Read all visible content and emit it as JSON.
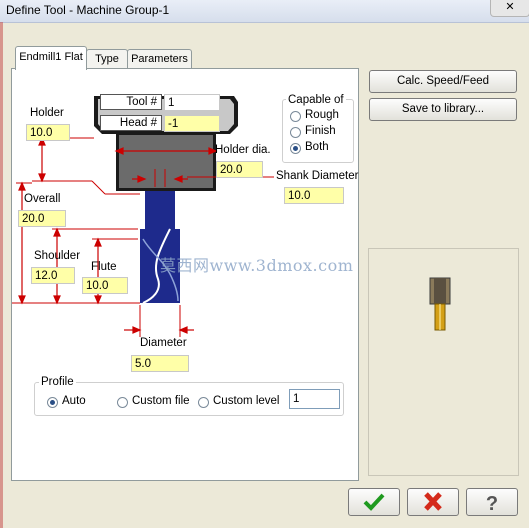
{
  "window": {
    "title": "Define Tool - Machine Group-1",
    "close": "✕"
  },
  "tabs": [
    "Endmill1 Flat",
    "Type",
    "Parameters"
  ],
  "header": {
    "tool_label": "Tool #",
    "tool_value": "1",
    "head_label": "Head #",
    "head_value": "-1"
  },
  "fields": {
    "holder_label": "Holder",
    "holder_value": "10.0",
    "holder_dia_label": "Holder dia.",
    "holder_dia_value": "20.0",
    "shank_label": "Shank Diameter",
    "shank_value": "10.0",
    "overall_label": "Overall",
    "overall_value": "20.0",
    "shoulder_label": "Shoulder",
    "shoulder_value": "12.0",
    "flute_label": "Flute",
    "flute_value": "10.0",
    "diameter_label": "Diameter",
    "diameter_value": "5.0"
  },
  "capable": {
    "title": "Capable of",
    "options": [
      "Rough",
      "Finish",
      "Both"
    ],
    "selected": "Both"
  },
  "profile": {
    "title": "Profile",
    "options": [
      "Auto",
      "Custom file",
      "Custom level"
    ],
    "selected": "Auto",
    "level_value": "1"
  },
  "buttons": {
    "calc": "Calc. Speed/Feed",
    "save": "Save to library..."
  },
  "watermark": "莫西网www.3dmox.com",
  "colors": {
    "field_bg": "#ffffa8",
    "dimension_red": "#cc0000",
    "tool_blue": "#1e2a8c"
  }
}
